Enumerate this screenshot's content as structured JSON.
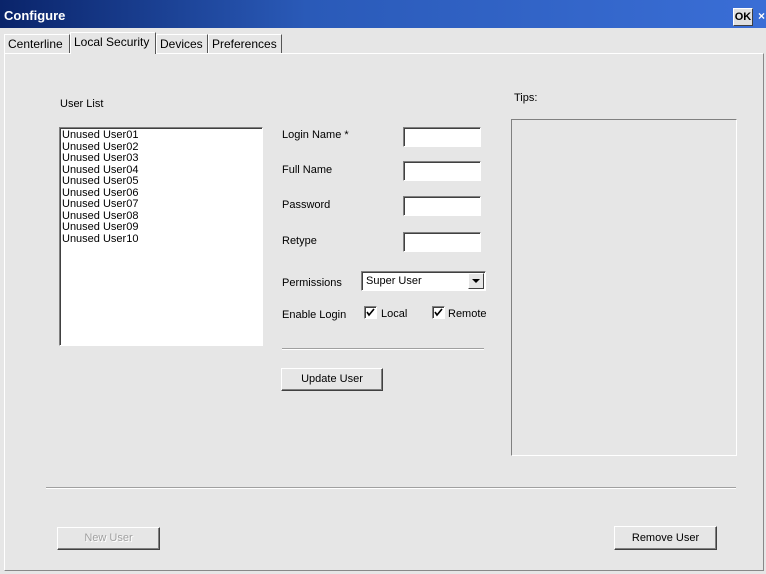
{
  "window": {
    "title": "Configure",
    "ok_label": "OK",
    "close_label": "×"
  },
  "tabs": [
    {
      "label": "Centerline",
      "active": false
    },
    {
      "label": "Local Security",
      "active": true
    },
    {
      "label": "Devices",
      "active": false
    },
    {
      "label": "Preferences",
      "active": false
    }
  ],
  "user_list": {
    "label": "User List",
    "items": [
      "Unused User01",
      "Unused User02",
      "Unused User03",
      "Unused User04",
      "Unused User05",
      "Unused User06",
      "Unused User07",
      "Unused User08",
      "Unused User09",
      "Unused User10"
    ]
  },
  "form": {
    "login_name_label": "Login Name *",
    "login_name_value": "",
    "full_name_label": "Full Name",
    "full_name_value": "",
    "password_label": "Password",
    "password_value": "",
    "retype_label": "Retype",
    "retype_value": "",
    "permissions_label": "Permissions",
    "permissions_value": "Super User",
    "enable_login_label": "Enable Login",
    "local_label": "Local",
    "local_checked": true,
    "remote_label": "Remote",
    "remote_checked": true,
    "update_button": "Update User"
  },
  "tips": {
    "label": "Tips:"
  },
  "footer": {
    "new_user_button": "New User",
    "new_user_enabled": false,
    "remove_user_button": "Remove User"
  },
  "icons": {
    "dropdown": "chevron-down-icon",
    "check": "check-icon"
  }
}
